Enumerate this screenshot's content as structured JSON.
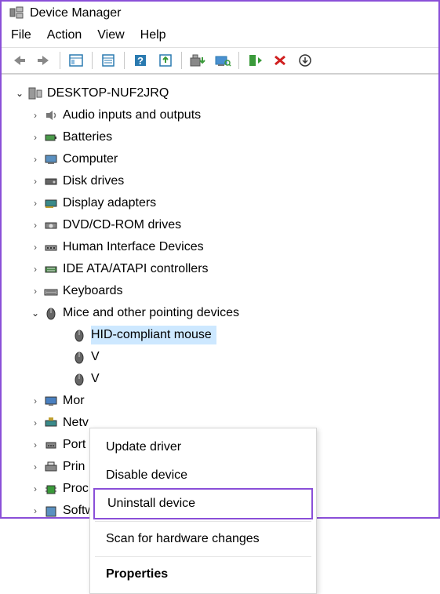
{
  "window": {
    "title": "Device Manager"
  },
  "menu": [
    "File",
    "Action",
    "View",
    "Help"
  ],
  "toolbar": {
    "back": "back-arrow",
    "forward": "forward-arrow",
    "show_hidden": "show-hidden",
    "properties": "properties",
    "help": "help",
    "update": "update-driver",
    "uninstall": "uninstall",
    "scan": "scan-hardware",
    "enable": "enable",
    "disable": "disable",
    "more": "more"
  },
  "tree": {
    "root": {
      "label": "DESKTOP-NUF2JRQ"
    },
    "items": [
      {
        "label": "Audio inputs and outputs"
      },
      {
        "label": "Batteries"
      },
      {
        "label": "Computer"
      },
      {
        "label": "Disk drives"
      },
      {
        "label": "Display adapters"
      },
      {
        "label": "DVD/CD-ROM drives"
      },
      {
        "label": "Human Interface Devices"
      },
      {
        "label": "IDE ATA/ATAPI controllers"
      },
      {
        "label": "Keyboards"
      },
      {
        "label": "Mice and other pointing devices"
      },
      {
        "label": "Monitors",
        "short": "Mor"
      },
      {
        "label": "Network adapters",
        "short": "Netv"
      },
      {
        "label": "Ports",
        "short": "Port"
      },
      {
        "label": "Print queues",
        "short": "Prin"
      },
      {
        "label": "Processors",
        "short": "Proc"
      },
      {
        "label": "Software devices",
        "short": "Software devices"
      }
    ],
    "mouse_children": [
      {
        "label": "HID-compliant mouse"
      },
      {
        "label": "",
        "short": "V"
      },
      {
        "label": "",
        "short": "V"
      }
    ]
  },
  "context_menu": {
    "update": "Update driver",
    "disable": "Disable device",
    "uninstall": "Uninstall device",
    "scan": "Scan for hardware changes",
    "properties": "Properties"
  }
}
